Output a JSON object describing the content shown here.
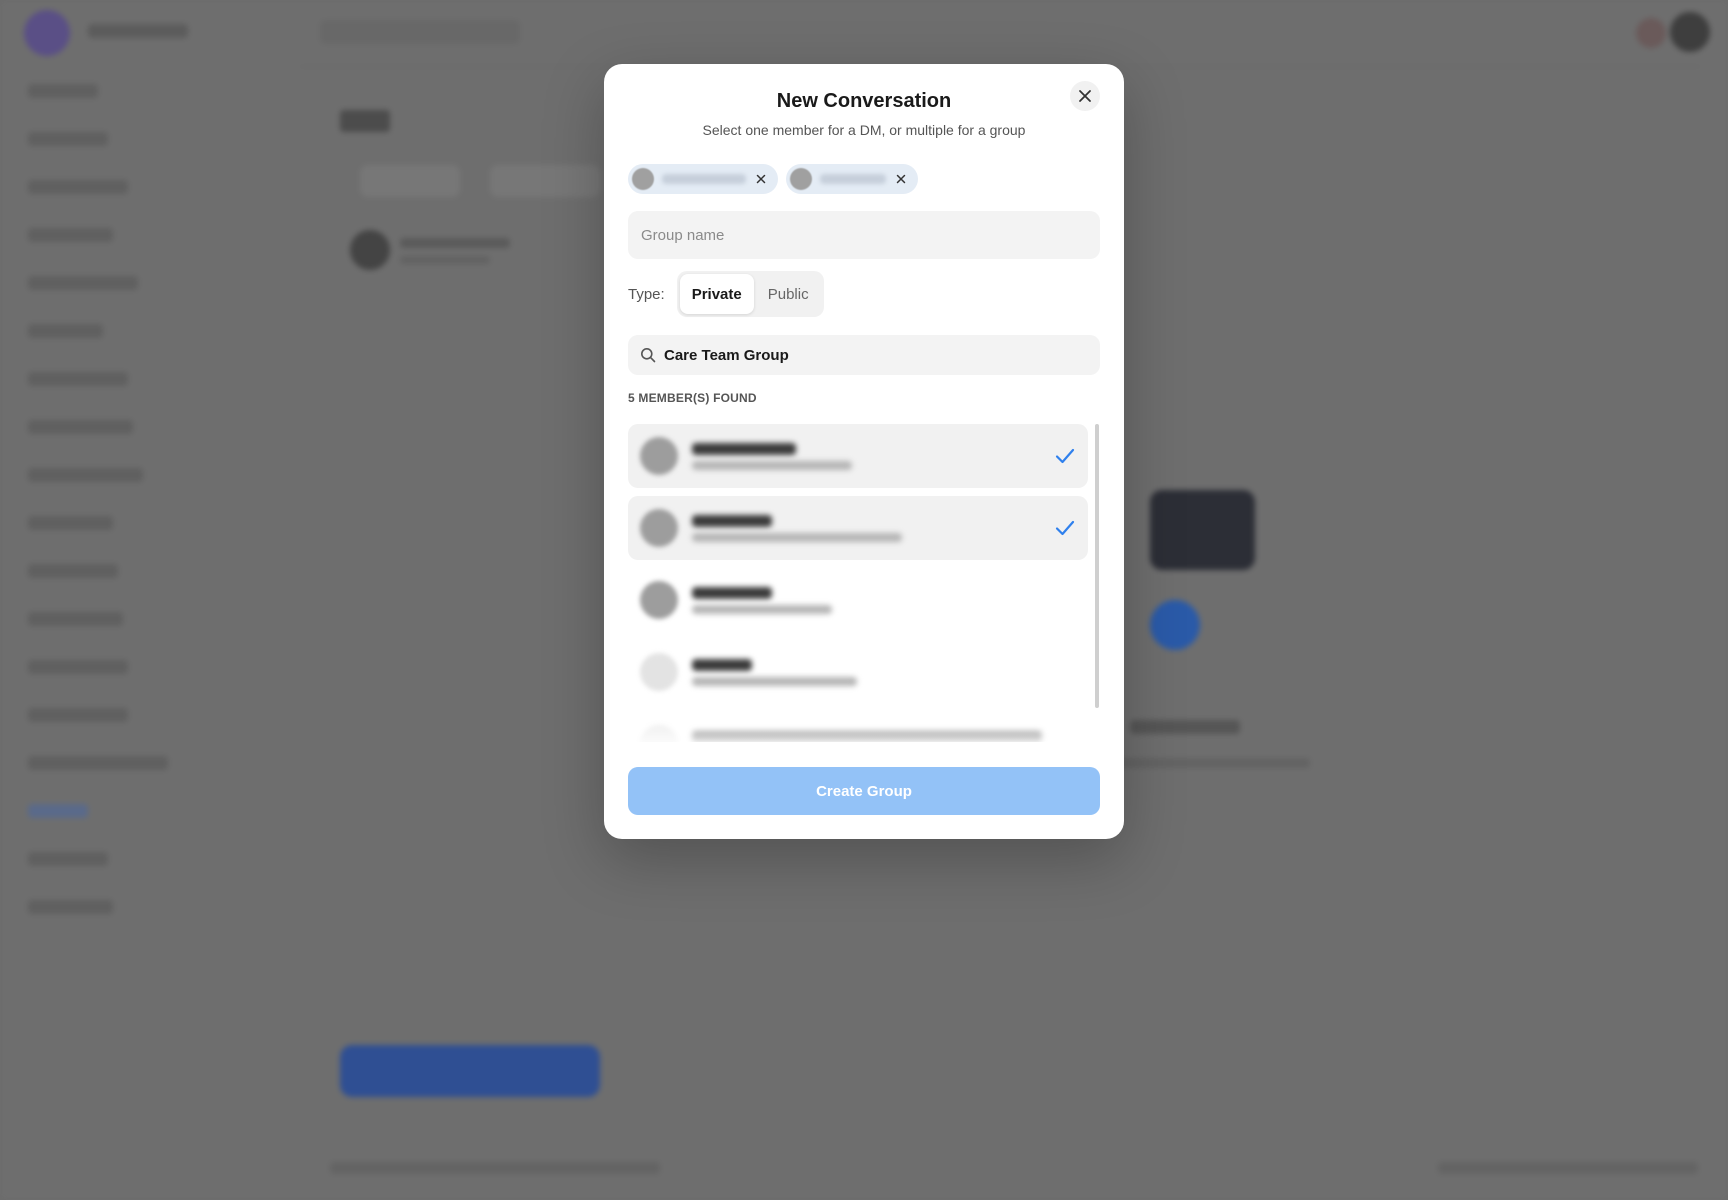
{
  "modal": {
    "title": "New Conversation",
    "subtitle": "Select one member for a DM, or multiple for a group",
    "close_icon": "close-icon",
    "selected_chips": [
      {
        "name": "",
        "remove_icon": "close-icon"
      },
      {
        "name": "",
        "remove_icon": "close-icon"
      }
    ],
    "group_name": {
      "placeholder": "Group name",
      "value": ""
    },
    "type": {
      "label": "Type:",
      "options": [
        "Private",
        "Public"
      ],
      "selected": "Private"
    },
    "search": {
      "icon": "search-icon",
      "value": "Care Team Group"
    },
    "found_count": "5 MEMBER(S) FOUND",
    "members": [
      {
        "selected": true
      },
      {
        "selected": true
      },
      {
        "selected": false
      },
      {
        "selected": false
      },
      {
        "selected": false
      }
    ],
    "create_button": "Create Group"
  },
  "colors": {
    "overlay": "#6b6b6b",
    "accent_check": "#2f80ed",
    "create_button_disabled": "#93c2f7",
    "chip_bg": "#e4ecf5"
  }
}
